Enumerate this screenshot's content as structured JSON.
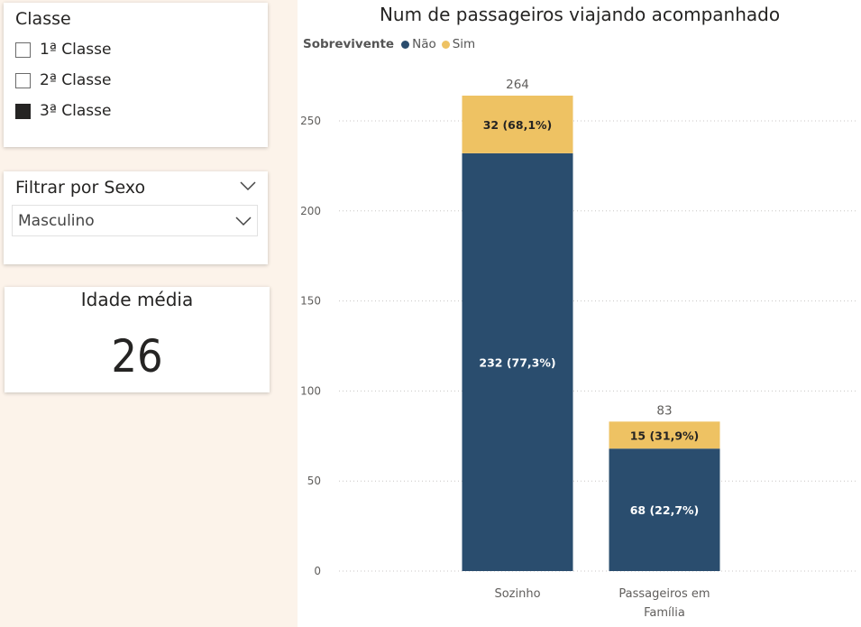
{
  "classe_slicer": {
    "title": "Classe",
    "items": [
      {
        "label": "1ª Classe",
        "checked": false
      },
      {
        "label": "2ª Classe",
        "checked": false
      },
      {
        "label": "3ª Classe",
        "checked": true
      }
    ]
  },
  "sexo_slicer": {
    "title": "Filtrar por Sexo",
    "selected": "Masculino",
    "icons": [
      "chevron-down-icon",
      "chevron-down-icon"
    ]
  },
  "kpi": {
    "title": "Idade média",
    "value": "26"
  },
  "colors": {
    "nao": "#2a4d6e",
    "sim": "#eec263",
    "gridline": "#c8c6c4"
  },
  "chart_data": {
    "type": "bar",
    "stacked": true,
    "title": "Num de passageiros viajando acompanhado",
    "legend_title": "Sobrevivente",
    "legend_position": "top-left",
    "categories": [
      "Sozinho",
      "Passageiros em Família"
    ],
    "series": [
      {
        "name": "Não",
        "color": "#2a4d6e",
        "values": [
          232,
          68
        ],
        "labels": [
          "232 (77,3%)",
          "68 (22,7%)"
        ]
      },
      {
        "name": "Sim",
        "color": "#eec263",
        "values": [
          32,
          15
        ],
        "labels": [
          "32 (68,1%)",
          "15 (31,9%)"
        ]
      }
    ],
    "totals": [
      264,
      83
    ],
    "ylim": [
      0,
      264
    ],
    "yticks": [
      0,
      50,
      100,
      150,
      200,
      250
    ],
    "grid": true,
    "xlabel": "",
    "ylabel": ""
  }
}
